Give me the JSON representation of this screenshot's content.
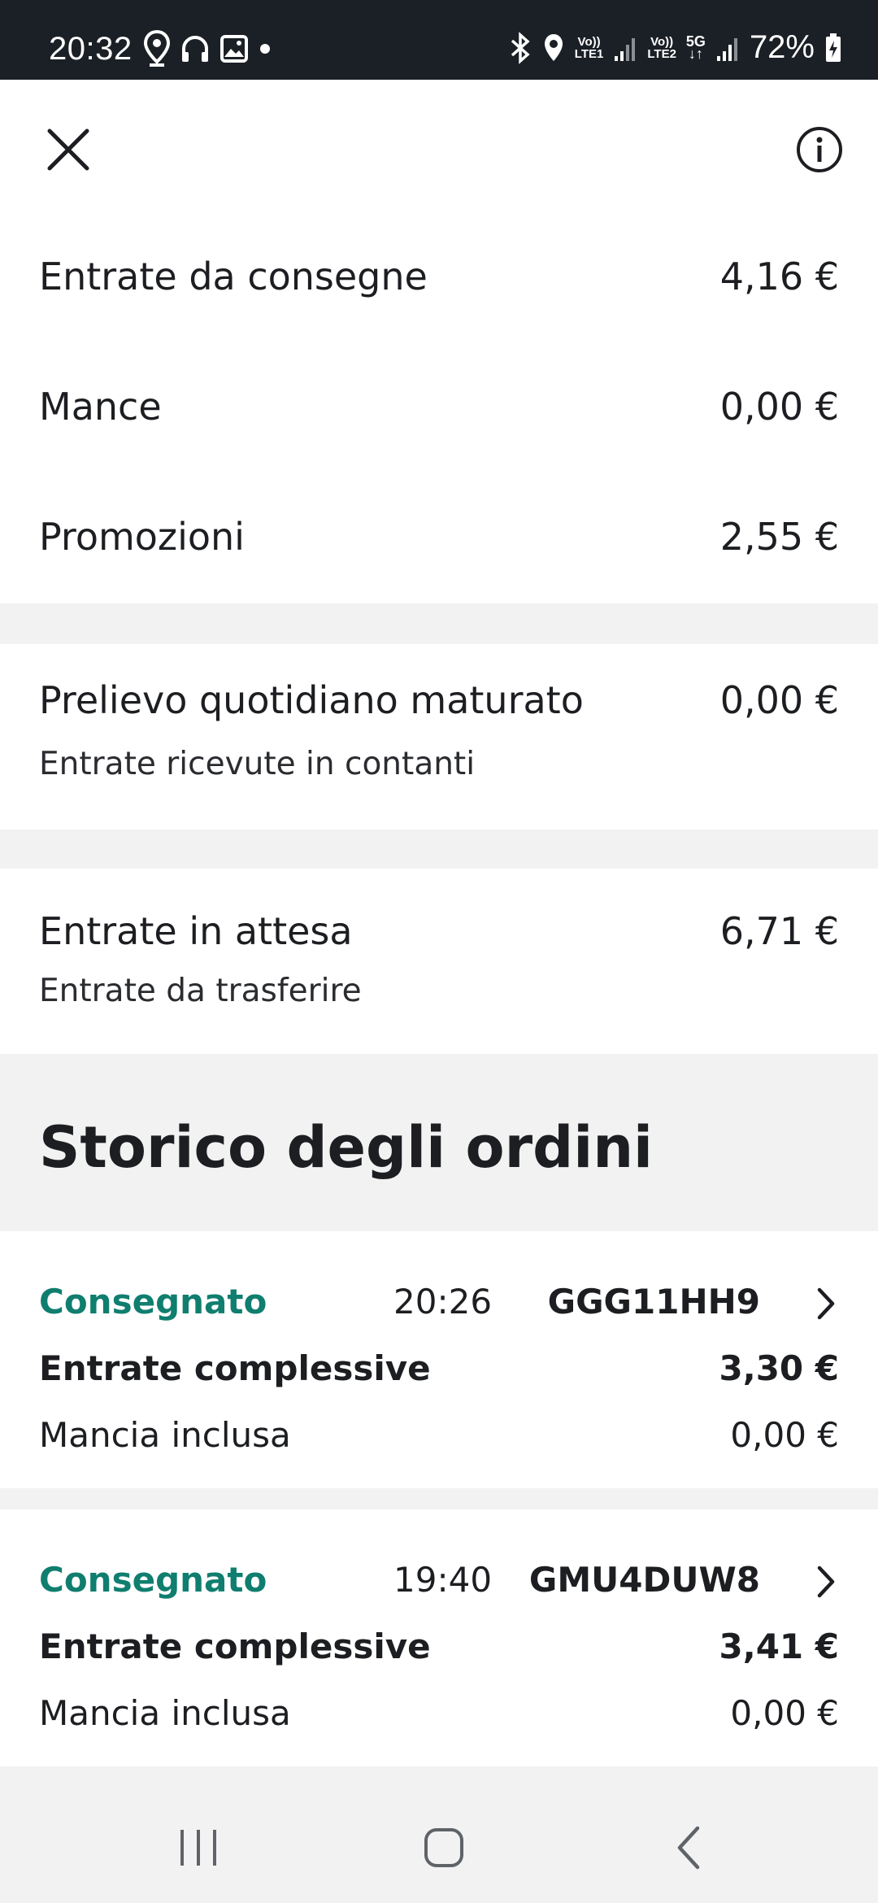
{
  "status_bar": {
    "time": "20:32",
    "battery": "72%",
    "sim1": [
      "Vo))",
      "LTE1"
    ],
    "sim2": [
      "Vo))",
      "LTE2"
    ],
    "network": "5G"
  },
  "summary": {
    "rows": [
      {
        "label": "Entrate da consegne",
        "value": "4,16 €"
      },
      {
        "label": "Mance",
        "value": "0,00 €"
      },
      {
        "label": "Promozioni",
        "value": "2,55 €"
      }
    ]
  },
  "daily": {
    "label": "Prelievo quotidiano maturato",
    "value": "0,00 €",
    "sub": "Entrate ricevute in contanti"
  },
  "pending": {
    "label": "Entrate in attesa",
    "value": "6,71 €",
    "sub": "Entrate da trasferire"
  },
  "history": {
    "title": "Storico degli ordini",
    "orders": [
      {
        "status": "Consegnato",
        "time": "20:26",
        "code": "GGG11HH9",
        "total_label": "Entrate complessive",
        "total": "3,30 €",
        "tip_label": "Mancia inclusa",
        "tip": "0,00 €"
      },
      {
        "status": "Consegnato",
        "time": "19:40",
        "code": "GMU4DUW8",
        "total_label": "Entrate complessive",
        "total": "3,41 €",
        "tip_label": "Mancia inclusa",
        "tip": "0,00 €"
      }
    ]
  },
  "colors": {
    "accent": "#107e6f",
    "status_bar_bg": "#1b2026",
    "background": "#f2f2f2"
  }
}
